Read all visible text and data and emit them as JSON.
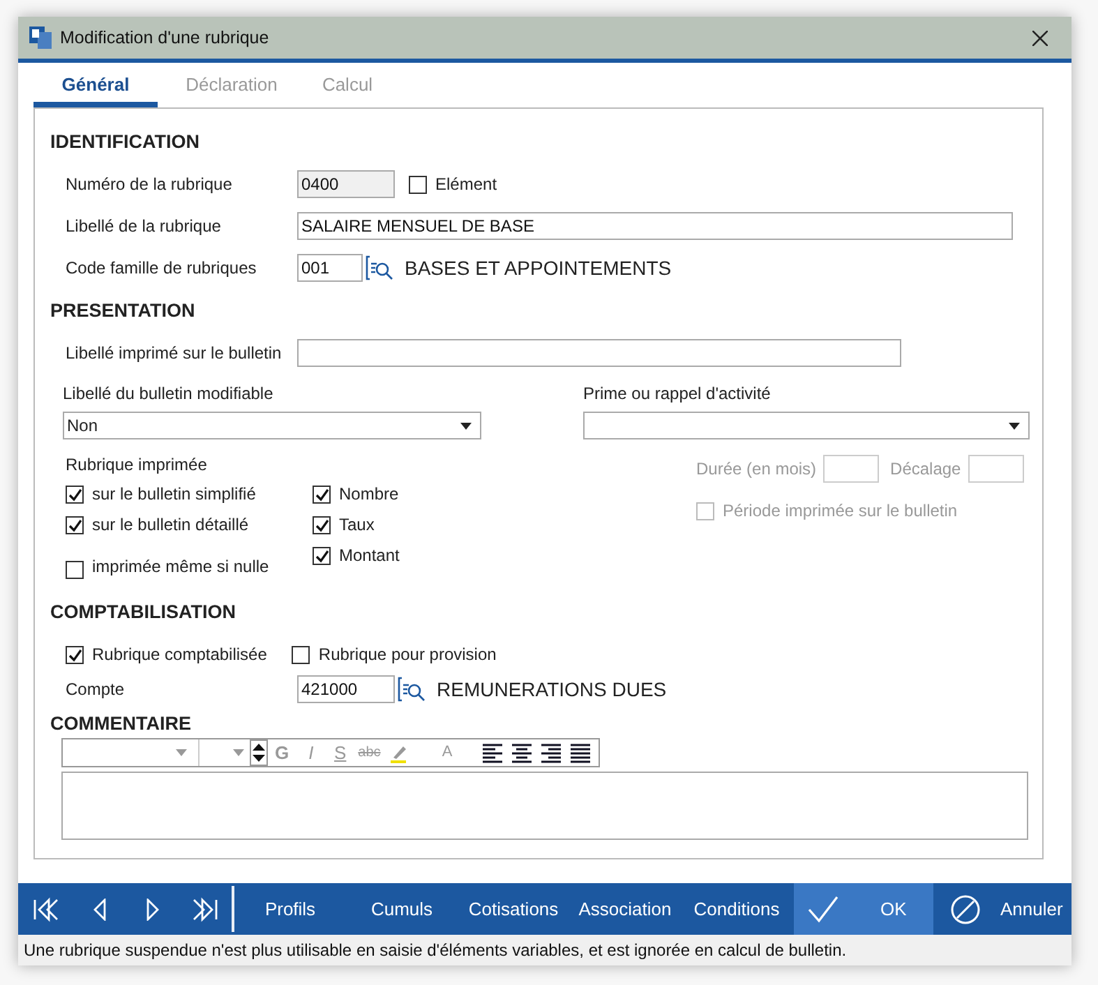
{
  "window": {
    "title": "Modification d'une rubrique"
  },
  "tabs": [
    {
      "label": "Général",
      "selected": true
    },
    {
      "label": "Déclaration",
      "selected": false
    },
    {
      "label": "Calcul",
      "selected": false
    }
  ],
  "identification": {
    "heading": "IDENTIFICATION",
    "numero": {
      "label": "Numéro de la rubrique",
      "value": "0400",
      "disabled": true
    },
    "element": {
      "label": "Elément",
      "checked": false
    },
    "libelle": {
      "label": "Libellé de la rubrique",
      "value": "SALAIRE MENSUEL DE BASE"
    },
    "famille": {
      "label": "Code famille de rubriques",
      "value": "001",
      "description": "BASES ET APPOINTEMENTS"
    }
  },
  "presentation": {
    "heading": "PRESENTATION",
    "libelle_imprime": {
      "label": "Libellé imprimé sur le bulletin"
    },
    "libelle_modifiable": {
      "label": "Libellé du bulletin modifiable",
      "value": "Non"
    },
    "prime": {
      "label": "Prime ou rappel d'activité"
    },
    "rubrique_imprimee": {
      "label": "Rubrique imprimée",
      "left": [
        {
          "label": "sur le bulletin simplifié",
          "checked": true
        },
        {
          "label": "sur le bulletin détaillé",
          "checked": true
        },
        {
          "label": "imprimée même si nulle",
          "checked": false
        }
      ],
      "right": [
        {
          "label": "Nombre",
          "checked": true
        },
        {
          "label": "Taux",
          "checked": true
        },
        {
          "label": "Montant",
          "checked": true
        }
      ]
    },
    "duree": {
      "label": "Durée (en mois)",
      "disabled": true
    },
    "decalage": {
      "label": "Décalage",
      "disabled": true
    },
    "periode": {
      "label": "Période imprimée sur le bulletin",
      "checked": false,
      "disabled": true
    }
  },
  "comptabilisation": {
    "heading": "COMPTABILISATION",
    "checkboxes": [
      {
        "label": "Rubrique comptabilisée",
        "checked": true
      },
      {
        "label": "Rubrique pour provision",
        "checked": false
      }
    ],
    "compte": {
      "label": "Compte",
      "value": "421000",
      "description": "REMUNERATIONS DUES"
    }
  },
  "commentaire": {
    "heading": "COMMENTAIRE",
    "format_buttons": [
      {
        "kind": "bold",
        "label": "G"
      },
      {
        "kind": "italic",
        "label": "I"
      },
      {
        "kind": "underline",
        "label": "S"
      },
      {
        "kind": "strike",
        "label": "abc"
      },
      {
        "kind": "highlight"
      },
      {
        "kind": "color",
        "label": "A"
      }
    ]
  },
  "actions": [
    {
      "label": "Profils"
    },
    {
      "label": "Cumuls"
    },
    {
      "label": "Cotisations"
    },
    {
      "label": "Association"
    },
    {
      "label": "Conditions"
    }
  ],
  "ok": {
    "label": "OK"
  },
  "cancel": {
    "label": "Annuler"
  },
  "status_bar": "Une rubrique suspendue n'est plus utilisable en saisie d'éléments variables, et est ignorée en calcul de bulletin."
}
